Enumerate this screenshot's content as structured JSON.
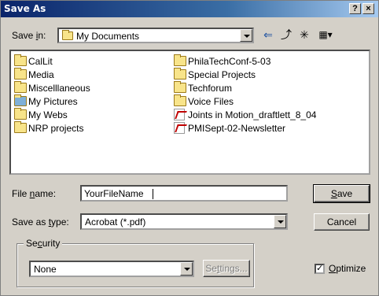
{
  "window": {
    "title": "Save As"
  },
  "titlebar_buttons": {
    "help": "?",
    "close": "×"
  },
  "save_in": {
    "label_prefix": "Save ",
    "label_accel": "i",
    "label_suffix": "n:",
    "value": "My Documents"
  },
  "toolbar": {
    "back_icon": "⇐",
    "up_icon": "⤴",
    "new_folder_icon": "✳",
    "view_icon": "▦▾"
  },
  "files": [
    {
      "name": "CalLit",
      "type": "folder"
    },
    {
      "name": "Media",
      "type": "folder"
    },
    {
      "name": "Miscelllaneous",
      "type": "folder"
    },
    {
      "name": "My Pictures",
      "type": "pictures-folder"
    },
    {
      "name": "My Webs",
      "type": "folder"
    },
    {
      "name": "NRP projects",
      "type": "folder"
    },
    {
      "name": "PhilaTechConf-5-03",
      "type": "folder"
    },
    {
      "name": "Special Projects",
      "type": "folder"
    },
    {
      "name": "Techforum",
      "type": "folder"
    },
    {
      "name": "Voice Files",
      "type": "folder"
    },
    {
      "name": "Joints in Motion_draftlett_8_04",
      "type": "pdf"
    },
    {
      "name": "PMISept-02-Newsletter",
      "type": "pdf"
    }
  ],
  "file_name": {
    "label_prefix": "File ",
    "label_accel": "n",
    "label_suffix": "ame:",
    "value": "YourFileName"
  },
  "save_as_type": {
    "label_prefix": "Save as ",
    "label_accel": "t",
    "label_suffix": "ype:",
    "value": "Acrobat (*.pdf)"
  },
  "buttons": {
    "save_accel": "S",
    "save_rest": "ave",
    "cancel": "Cancel",
    "settings_prefix": "Se",
    "settings_accel": "t",
    "settings_suffix": "tings..."
  },
  "security": {
    "title_prefix": "Se",
    "title_accel": "c",
    "title_suffix": "urity",
    "value": "None"
  },
  "optimize": {
    "checked": true,
    "check_mark": "✓",
    "accel": "O",
    "rest": "ptimize"
  }
}
